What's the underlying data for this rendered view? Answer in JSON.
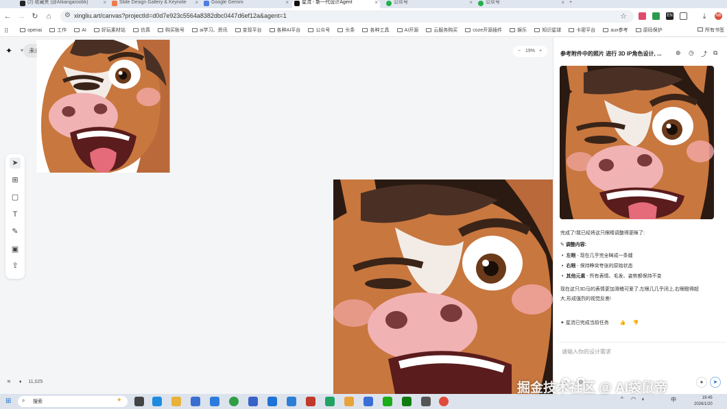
{
  "browser": {
    "tabs": [
      {
        "label": "(2) 收藏夹 (@AIkangaroobk)",
        "color": "#222222"
      },
      {
        "label": "Slide Design Gallery & Keynote",
        "color": "#f07a4a"
      },
      {
        "label": "Google Gemini",
        "color": "#4f7de0"
      },
      {
        "label": "星流 - 新一代设计Agent",
        "color": "#111111"
      },
      {
        "label": "公众号",
        "color": "#22b04c"
      },
      {
        "label": "公众号",
        "color": "#22b04c"
      }
    ],
    "new_tab": "+",
    "url": "xingliu.art/canvas?projectId=d0d7e923c5564a8382dbc0447d6ef12a&agent=1",
    "bookmarks": [
      "openai",
      "工作",
      "AI",
      "好玩素材站",
      "仿真",
      "购买账号",
      "ai学习、资讯",
      "变现平台",
      "各种AI平台",
      "公众号",
      "头条",
      "各种工具",
      "AI开源",
      "云服务购买",
      "coze开源插件",
      "娱乐",
      "知识星球",
      "卡密平台",
      "aux参考",
      "原码保护"
    ],
    "bookmarks_last": "所有书签",
    "extensions": [
      {
        "label": "",
        "color": "#e04b6a"
      },
      {
        "label": "",
        "color": "#2d9b4f"
      },
      {
        "label": "EN",
        "color": "#222222"
      },
      {
        "label": "",
        "color": "#555555"
      },
      {
        "label": "",
        "color": "#444444"
      },
      {
        "label": "",
        "color": "#333333"
      },
      {
        "label": "NB",
        "color": "#d94f3a"
      }
    ]
  },
  "canvas": {
    "project_name": "未命名",
    "zoom": "19%",
    "zoom_minus": "−",
    "zoom_plus": "+",
    "layer_count": "11,025",
    "tools": [
      "select",
      "frame",
      "rect",
      "text",
      "pen",
      "image",
      "upload"
    ]
  },
  "panel": {
    "title": "参考附件中的照片 进行 3D IP角色设计, ...",
    "intro": "完成了!我已经将这只眼睛调整得更眯了:",
    "section_title": "调整内容:",
    "bullets": [
      {
        "key": "左眼",
        "text": " - 现在几乎完全眯成一条缝"
      },
      {
        "key": "右眼",
        "text": " - 保持睁突夸张的原始状态"
      },
      {
        "key": "其他元素",
        "text": " - 所有表情、毛发、姿势都保持不变"
      }
    ],
    "summary_line1": "现在这只3D马的表情更加滑稽可爱了,左眼几几乎闭上,右眼瞪得超",
    "summary_line2": "大,形成强烈的视觉反差!",
    "status": "星流已完成当前任务",
    "input_placeholder": "请输入你的设计需求"
  },
  "taskbar": {
    "search": "搜索",
    "time": "19:45",
    "date": "2026/1/20",
    "ime": "中",
    "watermark": "掘金技术社区 @ AI袋鼠帝",
    "apps": [
      {
        "color": "#444444"
      },
      {
        "color": "#1f8be0"
      },
      {
        "color": "#e8b13a"
      },
      {
        "color": "#3b6fcf"
      },
      {
        "color": "#2e7be0"
      },
      {
        "color": "#2f9e44"
      },
      {
        "color": "#3a63c7"
      },
      {
        "color": "#1e73d6"
      },
      {
        "color": "#2d7fd6"
      },
      {
        "color": "#c0392b"
      },
      {
        "color": "#21a366"
      },
      {
        "color": "#e8a33a"
      },
      {
        "color": "#3a6ed6"
      },
      {
        "color": "#1aad19"
      },
      {
        "color": "#107c10"
      },
      {
        "color": "#555555"
      },
      {
        "color": "#e04b3a"
      }
    ]
  },
  "colors": {
    "accent": "#1b6fd1",
    "canvas_bg": "#f3f5f6",
    "horse_fur": "#b9693a",
    "horse_snout": "#f1b2b4",
    "horse_hair": "#4a3024"
  }
}
